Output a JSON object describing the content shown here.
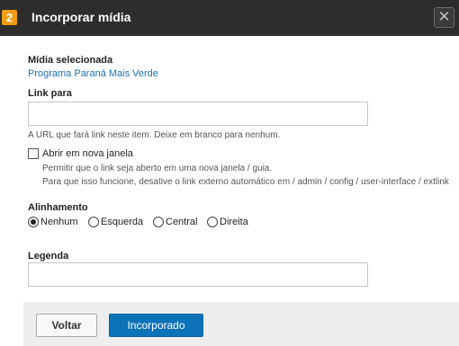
{
  "dialog": {
    "step_number": "2",
    "title": "Incorporar mídia",
    "close_symbol": "✕"
  },
  "selected_media": {
    "label": "Mídia selecionada",
    "value": "Programa Paraná Mais Verde"
  },
  "link_field": {
    "label": "Link para",
    "value": "",
    "help": "A URL que fará link neste item. Deixe em branco para nenhum."
  },
  "new_window": {
    "checked": false,
    "label": "Abrir em nova janela",
    "help_line1": "Permitir que o link seja aberto em uma nova janela / guia.",
    "help_line2": "Para que isso funcione, desative o link externo automático em / admin / config / user-interface / extlink"
  },
  "alignment": {
    "label": "Alinhamento",
    "selected": "Nenhum",
    "options": [
      "Nenhum",
      "Esquerda",
      "Central",
      "Direita"
    ]
  },
  "caption_field": {
    "label": "Legenda",
    "value": ""
  },
  "footer": {
    "back_label": "Voltar",
    "submit_label": "Incorporado"
  },
  "colors": {
    "titlebar": "#2d2d2d",
    "step_badge": "#f39c12",
    "link": "#1a72b7",
    "primary_button": "#0d73b8",
    "footer_bg": "#eeeeee"
  },
  "icons": {
    "close": "close-icon",
    "step": "step-number-badge"
  }
}
